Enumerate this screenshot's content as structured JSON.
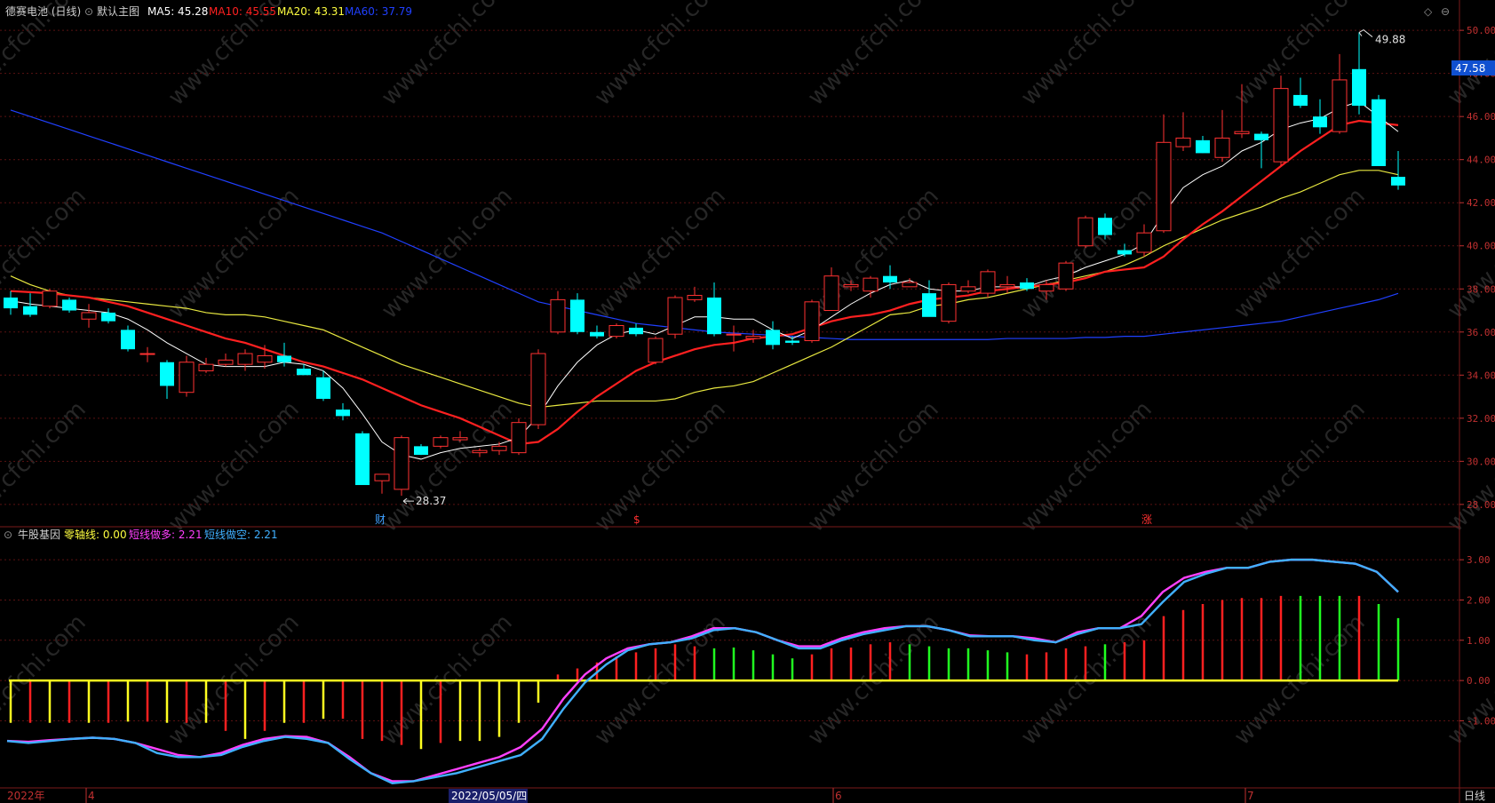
{
  "main_panel": {
    "stock_name": "德赛电池 (日线)",
    "template": "默认主图",
    "indicators": [
      {
        "label": "MA5: 45.28",
        "color": "#ffffff"
      },
      {
        "label": "MA10: 45.55",
        "color": "#ff2020"
      },
      {
        "label": "MA20: 43.31",
        "color": "#ffff40"
      },
      {
        "label": "MA60: 37.79",
        "color": "#2040ff"
      }
    ],
    "current_price_tag": "47.58",
    "high_marker": "49.88",
    "low_marker": "28.37",
    "event_markers": [
      "财",
      "$",
      "涨"
    ]
  },
  "sub_panel": {
    "title": "牛股基因",
    "indicators": [
      {
        "label": "零轴线: 0.00",
        "color": "#ffff40"
      },
      {
        "label": "短线做多: 2.21",
        "color": "#ff40ff"
      },
      {
        "label": "短线做空: 2.21",
        "color": "#40b0ff"
      }
    ]
  },
  "time_axis": {
    "labels": [
      "2022年",
      "4",
      "2022/05/05/四",
      "6",
      "7"
    ],
    "period": "日线"
  },
  "watermark": "www.cfchi.com",
  "chart_data": [
    {
      "type": "candlestick",
      "y_axis_labels": [
        "28.00",
        "30.00",
        "32.00",
        "34.00",
        "36.00",
        "38.00",
        "40.00",
        "42.00",
        "44.00",
        "46.00",
        "48.00",
        "50.00"
      ],
      "ylim": [
        27.5,
        50.5
      ],
      "up_color": "#ff3232",
      "down_color": "#00ffff",
      "ohlc": [
        [
          37.6,
          37.9,
          36.8,
          37.1
        ],
        [
          37.2,
          37.8,
          36.7,
          36.8
        ],
        [
          37.2,
          38.0,
          37.1,
          37.9
        ],
        [
          37.5,
          37.6,
          36.9,
          37.0
        ],
        [
          36.6,
          37.3,
          36.2,
          36.9
        ],
        [
          36.9,
          37.1,
          36.4,
          36.5
        ],
        [
          36.1,
          36.3,
          35.1,
          35.2
        ],
        [
          35.0,
          35.3,
          34.6,
          35.0
        ],
        [
          34.6,
          34.7,
          32.9,
          33.5
        ],
        [
          33.2,
          34.9,
          33.0,
          34.6
        ],
        [
          34.2,
          34.8,
          34.1,
          34.5
        ],
        [
          34.5,
          35.0,
          34.4,
          34.7
        ],
        [
          34.5,
          35.2,
          34.2,
          35.0
        ],
        [
          34.6,
          35.4,
          34.3,
          34.9
        ],
        [
          34.9,
          35.5,
          34.4,
          34.6
        ],
        [
          34.3,
          34.5,
          34.0,
          34.0
        ],
        [
          33.9,
          34.2,
          32.8,
          32.9
        ],
        [
          32.4,
          32.7,
          31.9,
          32.1
        ],
        [
          31.3,
          31.4,
          28.9,
          28.9
        ],
        [
          29.1,
          29.2,
          28.5,
          29.4
        ],
        [
          28.7,
          31.2,
          28.4,
          31.1
        ],
        [
          30.7,
          30.8,
          30.3,
          30.3
        ],
        [
          30.7,
          31.2,
          30.6,
          31.1
        ],
        [
          31.0,
          31.4,
          30.9,
          31.1
        ],
        [
          30.4,
          30.6,
          30.2,
          30.5
        ],
        [
          30.5,
          30.9,
          30.3,
          30.7
        ],
        [
          30.4,
          32.0,
          30.3,
          31.8
        ],
        [
          31.7,
          35.2,
          31.5,
          35.0
        ],
        [
          36.0,
          37.9,
          35.9,
          37.5
        ],
        [
          37.5,
          37.8,
          35.9,
          36.0
        ],
        [
          36.0,
          36.3,
          35.7,
          35.8
        ],
        [
          35.8,
          36.4,
          35.7,
          36.3
        ],
        [
          36.2,
          36.4,
          35.8,
          35.9
        ],
        [
          34.6,
          35.8,
          34.5,
          35.7
        ],
        [
          35.9,
          37.7,
          35.7,
          37.6
        ],
        [
          37.5,
          38.1,
          37.4,
          37.7
        ],
        [
          37.6,
          38.3,
          35.8,
          35.9
        ],
        [
          35.9,
          36.3,
          35.1,
          35.9
        ],
        [
          35.7,
          36.1,
          35.5,
          35.8
        ],
        [
          36.1,
          36.5,
          35.2,
          35.4
        ],
        [
          35.6,
          35.8,
          35.4,
          35.5
        ],
        [
          35.6,
          37.5,
          35.5,
          37.4
        ],
        [
          37.0,
          39.0,
          37.0,
          38.6
        ],
        [
          38.1,
          38.4,
          37.9,
          38.2
        ],
        [
          37.9,
          38.6,
          37.6,
          38.5
        ],
        [
          38.6,
          39.1,
          38.0,
          38.3
        ],
        [
          38.1,
          38.5,
          38.1,
          38.3
        ],
        [
          37.8,
          38.4,
          37.3,
          36.7
        ],
        [
          36.5,
          38.3,
          36.4,
          38.2
        ],
        [
          37.9,
          38.4,
          37.8,
          38.1
        ],
        [
          37.8,
          38.9,
          37.6,
          38.8
        ],
        [
          38.1,
          38.6,
          37.8,
          38.2
        ],
        [
          38.3,
          38.5,
          37.9,
          38.0
        ],
        [
          37.9,
          38.4,
          37.5,
          38.2
        ],
        [
          38.0,
          39.3,
          37.9,
          39.2
        ],
        [
          40.0,
          41.4,
          39.9,
          41.3
        ],
        [
          41.3,
          41.5,
          40.3,
          40.5
        ],
        [
          39.8,
          40.1,
          39.5,
          39.6
        ],
        [
          39.7,
          41.0,
          39.5,
          40.6
        ],
        [
          40.7,
          46.1,
          40.6,
          44.8
        ],
        [
          44.6,
          46.2,
          44.4,
          45.0
        ],
        [
          44.9,
          45.1,
          44.3,
          44.3
        ],
        [
          44.1,
          46.3,
          43.9,
          45.0
        ],
        [
          45.2,
          47.5,
          45.0,
          45.3
        ],
        [
          45.2,
          45.3,
          43.6,
          44.9
        ],
        [
          43.9,
          47.9,
          43.7,
          47.3
        ],
        [
          47.0,
          47.8,
          46.4,
          46.5
        ],
        [
          46.0,
          46.8,
          45.2,
          45.5
        ],
        [
          45.3,
          48.9,
          45.2,
          47.7
        ],
        [
          48.2,
          49.9,
          46.1,
          46.5
        ],
        [
          46.8,
          47.0,
          43.7,
          43.7
        ],
        [
          43.2,
          44.4,
          42.6,
          42.8
        ]
      ],
      "ma5": [
        37.45,
        37.3,
        37.2,
        37.1,
        37.0,
        36.9,
        36.6,
        36.1,
        35.5,
        35.0,
        34.5,
        34.4,
        34.4,
        34.4,
        34.6,
        34.5,
        34.2,
        33.4,
        32.2,
        30.9,
        30.3,
        30.1,
        30.4,
        30.6,
        30.7,
        30.8,
        31.1,
        32.1,
        33.5,
        34.6,
        35.4,
        35.9,
        36.1,
        35.9,
        36.3,
        36.7,
        36.7,
        36.6,
        36.6,
        36.1,
        35.7,
        36.1,
        36.7,
        37.3,
        37.8,
        38.2,
        38.4,
        38.0,
        37.9,
        37.9,
        38.1,
        38.1,
        38.1,
        38.4,
        38.6,
        39.0,
        39.3,
        39.6,
        40.1,
        41.5,
        42.7,
        43.3,
        43.7,
        44.4,
        44.8,
        45.4,
        45.7,
        45.9,
        46.4,
        46.7,
        46.0,
        45.3
      ],
      "ma10": [
        37.9,
        37.85,
        37.8,
        37.7,
        37.6,
        37.4,
        37.2,
        36.9,
        36.6,
        36.3,
        36.0,
        35.7,
        35.5,
        35.2,
        34.9,
        34.6,
        34.4,
        34.1,
        33.8,
        33.4,
        33.0,
        32.6,
        32.3,
        32.0,
        31.6,
        31.2,
        30.8,
        30.9,
        31.5,
        32.3,
        33.0,
        33.6,
        34.2,
        34.6,
        34.9,
        35.2,
        35.4,
        35.5,
        35.7,
        35.8,
        35.9,
        36.2,
        36.5,
        36.7,
        36.8,
        37.0,
        37.3,
        37.5,
        37.6,
        37.7,
        37.9,
        38.0,
        38.1,
        38.2,
        38.3,
        38.5,
        38.8,
        38.9,
        39.0,
        39.5,
        40.3,
        41.0,
        41.6,
        42.3,
        43.0,
        43.7,
        44.4,
        45.0,
        45.6,
        45.8,
        45.7,
        45.6
      ],
      "ma20": [
        38.6,
        38.2,
        37.9,
        37.7,
        37.6,
        37.5,
        37.4,
        37.3,
        37.2,
        37.1,
        36.9,
        36.8,
        36.8,
        36.7,
        36.5,
        36.3,
        36.1,
        35.7,
        35.3,
        34.9,
        34.5,
        34.2,
        33.9,
        33.6,
        33.3,
        33.0,
        32.7,
        32.5,
        32.6,
        32.7,
        32.8,
        32.8,
        32.8,
        32.8,
        32.9,
        33.2,
        33.4,
        33.5,
        33.7,
        34.1,
        34.5,
        34.9,
        35.3,
        35.8,
        36.3,
        36.8,
        36.9,
        37.2,
        37.3,
        37.5,
        37.6,
        37.8,
        38.0,
        38.2,
        38.4,
        38.6,
        38.8,
        39.1,
        39.5,
        40.0,
        40.4,
        40.8,
        41.2,
        41.5,
        41.8,
        42.2,
        42.5,
        42.9,
        43.3,
        43.5,
        43.5,
        43.3
      ],
      "ma60": [
        46.3,
        46.0,
        45.7,
        45.4,
        45.1,
        44.8,
        44.5,
        44.2,
        43.9,
        43.6,
        43.3,
        43.0,
        42.7,
        42.4,
        42.1,
        41.8,
        41.5,
        41.2,
        40.9,
        40.6,
        40.2,
        39.8,
        39.4,
        39.0,
        38.6,
        38.2,
        37.8,
        37.4,
        37.2,
        37.0,
        36.8,
        36.6,
        36.4,
        36.3,
        36.2,
        36.1,
        36.0,
        35.95,
        35.9,
        35.85,
        35.8,
        35.75,
        35.7,
        35.65,
        35.65,
        35.65,
        35.65,
        35.65,
        35.65,
        35.65,
        35.65,
        35.7,
        35.7,
        35.7,
        35.7,
        35.75,
        35.75,
        35.8,
        35.8,
        35.9,
        36.0,
        36.1,
        36.2,
        36.3,
        36.4,
        36.5,
        36.7,
        36.9,
        37.1,
        37.3,
        37.5,
        37.79
      ]
    },
    {
      "type": "indicator",
      "y_axis_labels": [
        "-1.00",
        "0.00",
        "1.00",
        "2.00",
        "3.00"
      ],
      "ylim": [
        -2.6,
        3.4
      ],
      "bars": [
        -1.05,
        -1.05,
        -1.05,
        -1.05,
        -1.05,
        -1.05,
        -1.02,
        -1.02,
        -1.05,
        -1.05,
        -1.05,
        -1.25,
        -1.45,
        -1.25,
        -1.05,
        -1.05,
        -0.95,
        -0.95,
        -1.45,
        -1.5,
        -1.6,
        -1.7,
        -1.55,
        -1.5,
        -1.5,
        -1.4,
        -1.05,
        -0.55,
        0.15,
        0.3,
        0.45,
        0.6,
        0.7,
        0.8,
        0.9,
        0.85,
        0.8,
        0.82,
        0.75,
        0.65,
        0.55,
        0.65,
        0.8,
        0.82,
        0.9,
        0.95,
        0.9,
        0.85,
        0.8,
        0.8,
        0.75,
        0.7,
        0.65,
        0.7,
        0.8,
        0.85,
        0.9,
        0.95,
        1.0,
        1.6,
        1.75,
        1.9,
        2.0,
        2.05,
        2.05,
        2.1,
        2.1,
        2.1,
        2.1,
        2.1,
        1.9,
        1.55
      ],
      "bar_colors": [
        "y",
        "r",
        "y",
        "r",
        "y",
        "r",
        "y",
        "r",
        "y",
        "r",
        "y",
        "r",
        "y",
        "r",
        "y",
        "r",
        "y",
        "r",
        "r",
        "r",
        "r",
        "y",
        "r",
        "y",
        "y",
        "y",
        "y",
        "y",
        "r",
        "r",
        "r",
        "r",
        "r",
        "r",
        "r",
        "r",
        "g",
        "g",
        "g",
        "g",
        "g",
        "r",
        "r",
        "r",
        "r",
        "r",
        "g",
        "g",
        "g",
        "g",
        "g",
        "g",
        "r",
        "r",
        "r",
        "r",
        "g",
        "r",
        "r",
        "r",
        "r",
        "r",
        "r",
        "r",
        "r",
        "r",
        "g",
        "g",
        "g",
        "r",
        "g",
        "g"
      ],
      "series": [
        {
          "name": "短线做多",
          "color": "#ff40ff",
          "values": [
            -1.5,
            -1.52,
            -1.48,
            -1.45,
            -1.42,
            -1.45,
            -1.55,
            -1.7,
            -1.85,
            -1.9,
            -1.8,
            -1.6,
            -1.45,
            -1.38,
            -1.4,
            -1.55,
            -1.9,
            -2.3,
            -2.5,
            -2.5,
            -2.35,
            -2.2,
            -2.05,
            -1.9,
            -1.65,
            -1.2,
            -0.45,
            0.15,
            0.55,
            0.8,
            0.9,
            0.95,
            1.1,
            1.3,
            1.3,
            1.2,
            1.0,
            0.85,
            0.85,
            1.05,
            1.2,
            1.3,
            1.35,
            1.35,
            1.25,
            1.12,
            1.1,
            1.1,
            1.05,
            0.95,
            1.2,
            1.3,
            1.3,
            1.6,
            2.2,
            2.55,
            2.7,
            2.8,
            2.8,
            2.95,
            3.0,
            3.0,
            2.95,
            2.9,
            2.7,
            2.2
          ]
        },
        {
          "name": "短线做空",
          "color": "#40b0ff",
          "values": [
            -1.5,
            -1.55,
            -1.5,
            -1.45,
            -1.42,
            -1.45,
            -1.55,
            -1.8,
            -1.9,
            -1.9,
            -1.85,
            -1.65,
            -1.5,
            -1.4,
            -1.45,
            -1.55,
            -1.95,
            -2.3,
            -2.55,
            -2.5,
            -2.4,
            -2.3,
            -2.15,
            -2.0,
            -1.85,
            -1.45,
            -0.7,
            -0.05,
            0.4,
            0.75,
            0.9,
            0.95,
            1.05,
            1.25,
            1.3,
            1.2,
            1.0,
            0.8,
            0.8,
            1.0,
            1.15,
            1.25,
            1.35,
            1.35,
            1.25,
            1.1,
            1.1,
            1.1,
            1.0,
            0.95,
            1.15,
            1.3,
            1.3,
            1.4,
            1.95,
            2.45,
            2.65,
            2.8,
            2.8,
            2.95,
            3.0,
            3.0,
            2.95,
            2.9,
            2.7,
            2.2
          ]
        }
      ]
    }
  ]
}
